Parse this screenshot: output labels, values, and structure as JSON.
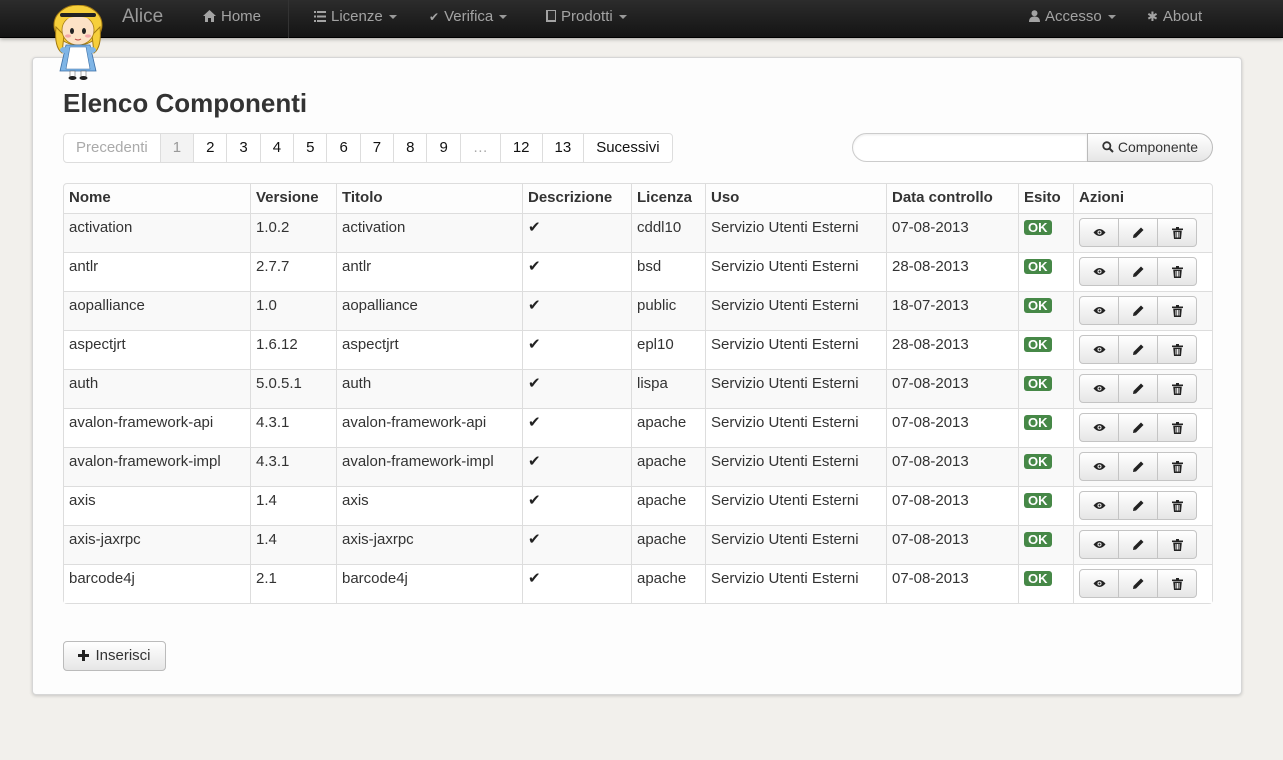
{
  "navbar": {
    "brand": "Alice",
    "home": "Home",
    "licenze": "Licenze",
    "verifica": "Verifica",
    "prodotti": "Prodotti",
    "accesso": "Accesso",
    "about": "About"
  },
  "page": {
    "title": "Elenco Componenti"
  },
  "pagination": {
    "prev": "Precedenti",
    "pages": [
      "1",
      "2",
      "3",
      "4",
      "5",
      "6",
      "7",
      "8",
      "9",
      "…",
      "12",
      "13"
    ],
    "active": "1",
    "next": "Sucessivi"
  },
  "search": {
    "value": "",
    "placeholder": "",
    "button_label": "Componente"
  },
  "table": {
    "headers": [
      "Nome",
      "Versione",
      "Titolo",
      "Descrizione",
      "Licenza",
      "Uso",
      "Data controllo",
      "Esito",
      "Azioni"
    ],
    "rows": [
      {
        "nome": "activation",
        "versione": "1.0.2",
        "titolo": "activation",
        "licenza": "cddl10",
        "uso": "Servizio Utenti Esterni",
        "data": "07-08-2013",
        "esito": "OK"
      },
      {
        "nome": "antlr",
        "versione": "2.7.7",
        "titolo": "antlr",
        "licenza": "bsd",
        "uso": "Servizio Utenti Esterni",
        "data": "28-08-2013",
        "esito": "OK"
      },
      {
        "nome": "aopalliance",
        "versione": "1.0",
        "titolo": "aopalliance",
        "licenza": "public",
        "uso": "Servizio Utenti Esterni",
        "data": "18-07-2013",
        "esito": "OK"
      },
      {
        "nome": "aspectjrt",
        "versione": "1.6.12",
        "titolo": "aspectjrt",
        "licenza": "epl10",
        "uso": "Servizio Utenti Esterni",
        "data": "28-08-2013",
        "esito": "OK"
      },
      {
        "nome": "auth",
        "versione": "5.0.5.1",
        "titolo": "auth",
        "licenza": "lispa",
        "uso": "Servizio Utenti Esterni",
        "data": "07-08-2013",
        "esito": "OK"
      },
      {
        "nome": "avalon-framework-api",
        "versione": "4.3.1",
        "titolo": "avalon-framework-api",
        "licenza": "apache",
        "uso": "Servizio Utenti Esterni",
        "data": "07-08-2013",
        "esito": "OK"
      },
      {
        "nome": "avalon-framework-impl",
        "versione": "4.3.1",
        "titolo": "avalon-framework-impl",
        "licenza": "apache",
        "uso": "Servizio Utenti Esterni",
        "data": "07-08-2013",
        "esito": "OK"
      },
      {
        "nome": "axis",
        "versione": "1.4",
        "titolo": "axis",
        "licenza": "apache",
        "uso": "Servizio Utenti Esterni",
        "data": "07-08-2013",
        "esito": "OK"
      },
      {
        "nome": "axis-jaxrpc",
        "versione": "1.4",
        "titolo": "axis-jaxrpc",
        "licenza": "apache",
        "uso": "Servizio Utenti Esterni",
        "data": "07-08-2013",
        "esito": "OK"
      },
      {
        "nome": "barcode4j",
        "versione": "2.1",
        "titolo": "barcode4j",
        "licenza": "apache",
        "uso": "Servizio Utenti Esterni",
        "data": "07-08-2013",
        "esito": "OK"
      }
    ]
  },
  "actions": {
    "insert_label": "Inserisci"
  },
  "colors": {
    "ok_badge": "#468847",
    "navbar": "#1b1b1b",
    "background": "#f2f0ec"
  },
  "icons": {
    "home": "home-icon",
    "licenze": "list-icon",
    "verifica": "check-icon",
    "prodotti": "book-icon",
    "accesso": "user-icon",
    "about": "asterisk-icon",
    "search": "search-icon",
    "view": "eye-icon",
    "edit": "pencil-icon",
    "delete": "trash-icon",
    "insert": "plus-icon"
  }
}
